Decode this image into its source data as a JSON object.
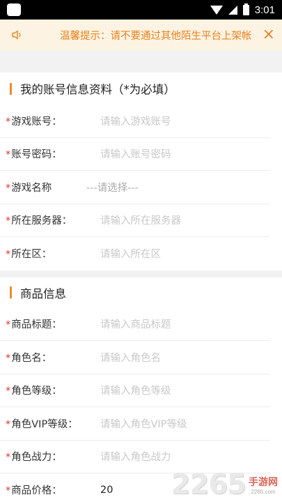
{
  "status_bar": {
    "time": "3:01"
  },
  "notice": {
    "text": "温馨提示：请不要通过其他陌生平台上架帐"
  },
  "account_section": {
    "title": "我的账号信息资料（*为必填）",
    "rows": [
      {
        "label": "游戏账号：",
        "placeholder": "请输入游戏账号"
      },
      {
        "label": "账号密码：",
        "placeholder": "请输入账号密码"
      },
      {
        "label": "游戏名称",
        "placeholder": "---请选择---"
      },
      {
        "label": "所在服务器：",
        "placeholder": "请输入所在服务器"
      },
      {
        "label": "所在区：",
        "placeholder": "请输入所在区"
      }
    ]
  },
  "product_section": {
    "title": "商品信息",
    "rows": [
      {
        "label": "商品标题：",
        "placeholder": "请输入商品标题"
      },
      {
        "label": "角色名：",
        "placeholder": "请输入角色名"
      },
      {
        "label": "角色等级：",
        "placeholder": "请输入角色等级"
      },
      {
        "label": "角色VIP等级：",
        "placeholder": "请输入角色VIP等级"
      },
      {
        "label": "角色战力：",
        "placeholder": "请输入角色战力"
      },
      {
        "label": "商品价格：",
        "value": "20"
      }
    ]
  },
  "watermark": {
    "number": "2265",
    "name": "手游网",
    "url": "2265.com"
  },
  "colors": {
    "accent": "#f08a2a",
    "required": "#e0332f",
    "notice_bg": "#fdf3e3",
    "notice_text": "#e8831e"
  }
}
